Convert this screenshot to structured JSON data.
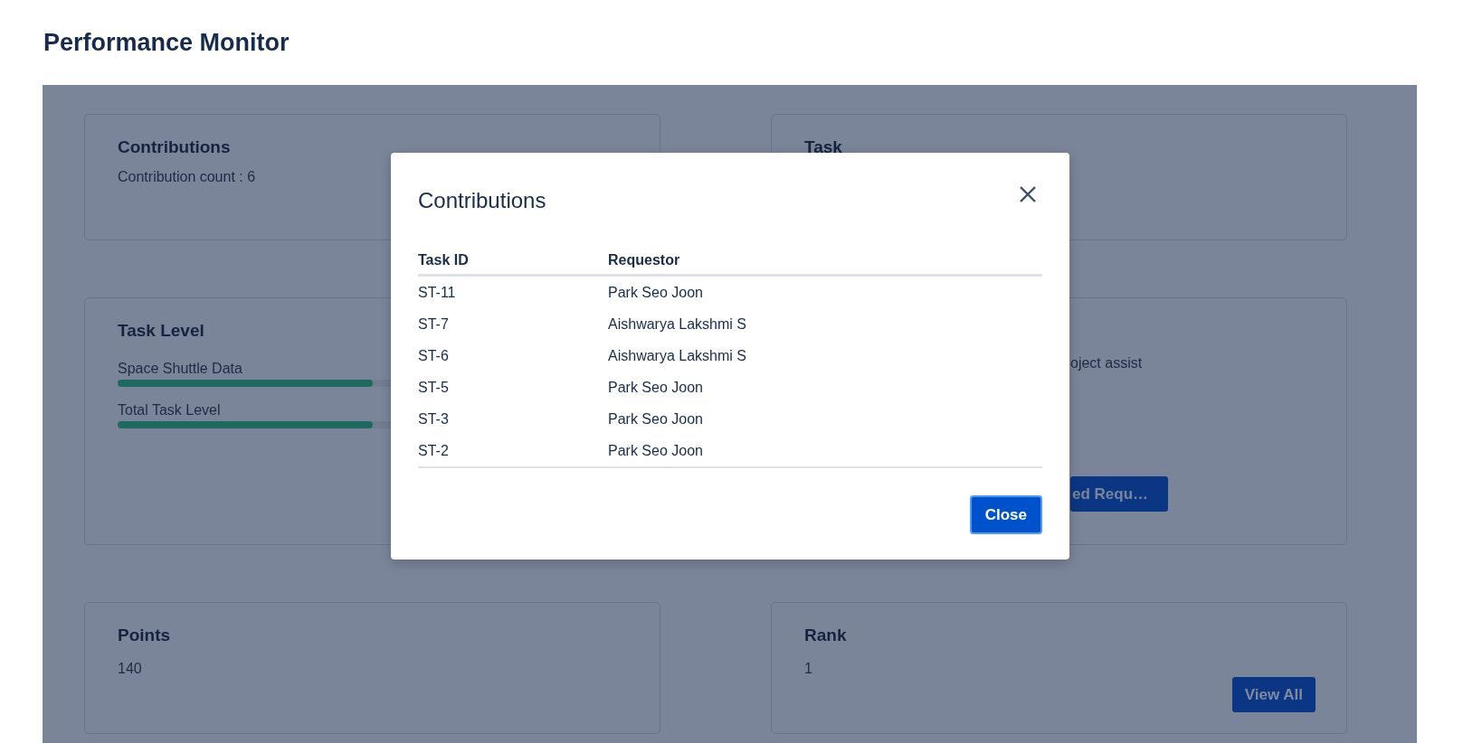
{
  "page": {
    "title": "Performance Monitor"
  },
  "cards": [
    {
      "kind": "count",
      "title": "Contributions",
      "text": "Contribution count : 6"
    },
    {
      "kind": "title",
      "title": "Task"
    },
    {
      "kind": "levels",
      "title": "Task Level",
      "bars": [
        {
          "label": "Space Shuttle Data",
          "level": 0.5
        },
        {
          "label": "Total Task Level",
          "level": 0.5
        }
      ]
    },
    {
      "kind": "partial",
      "text": "oject assist",
      "button": "ed Requ…"
    },
    {
      "kind": "value",
      "title": "Points",
      "text": "140"
    },
    {
      "kind": "value",
      "title": "Rank",
      "text": "1",
      "button": "View All"
    }
  ],
  "modal": {
    "title": "Contributions",
    "columns": [
      "Task ID",
      "Requestor"
    ],
    "rows": [
      [
        "ST-11",
        "Park Seo Joon"
      ],
      [
        "ST-7",
        "Aishwarya Lakshmi S"
      ],
      [
        "ST-6",
        "Aishwarya Lakshmi S"
      ],
      [
        "ST-5",
        "Park Seo Joon"
      ],
      [
        "ST-3",
        "Park Seo Joon"
      ],
      [
        "ST-2",
        "Park Seo Joon"
      ]
    ],
    "close_button": "Close"
  }
}
